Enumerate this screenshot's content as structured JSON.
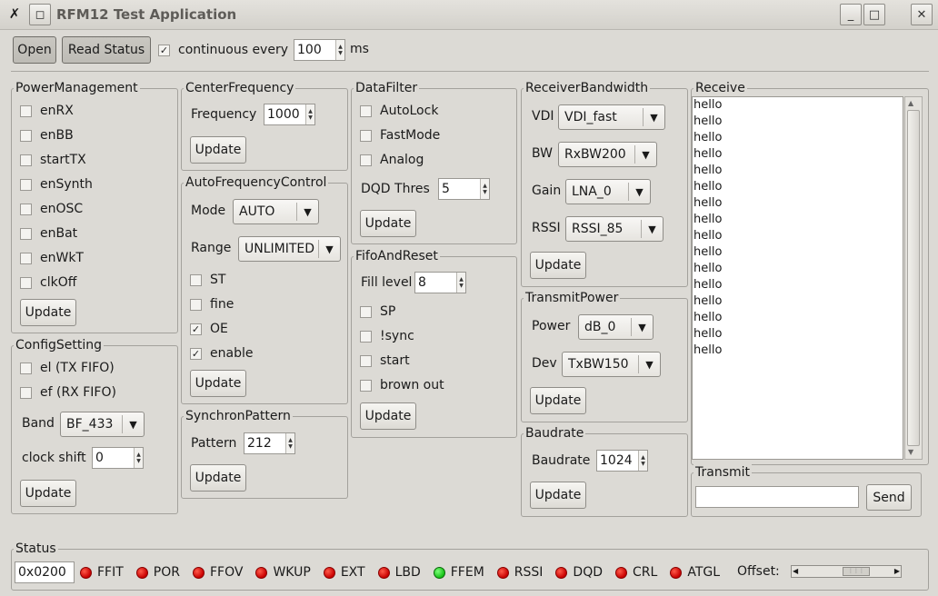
{
  "window": {
    "title": "RFM12 Test Application",
    "minimize": "_",
    "maximize": "□",
    "close": "✕",
    "menu_glyph": "✗",
    "pin_glyph": "◻"
  },
  "toolbar": {
    "open": "Open",
    "read_status": "Read Status",
    "continuous": "continuous every",
    "continuous_checked": true,
    "interval": "100",
    "unit": "ms"
  },
  "power": {
    "title": "PowerManagement",
    "items": [
      {
        "label": "enRX"
      },
      {
        "label": "enBB"
      },
      {
        "label": "startTX"
      },
      {
        "label": "enSynth"
      },
      {
        "label": "enOSC"
      },
      {
        "label": "enBat"
      },
      {
        "label": "enWkT"
      },
      {
        "label": "clkOff"
      }
    ],
    "update": "Update"
  },
  "config": {
    "title": "ConfigSetting",
    "el": "el (TX FIFO)",
    "ef": "ef (RX FIFO)",
    "band_label": "Band",
    "band_value": "BF_433",
    "clock_label": "clock shift",
    "clock_value": "0",
    "update": "Update"
  },
  "center": {
    "title": "CenterFrequency",
    "freq_label": "Frequency",
    "freq_value": "1000",
    "update": "Update"
  },
  "afc": {
    "title": "AutoFrequencyControl",
    "mode_label": "Mode",
    "mode_value": "AUTO",
    "range_label": "Range",
    "range_value": "UNLIMITED",
    "st": "ST",
    "fine": "fine",
    "oe": "OE",
    "enable": "enable",
    "update": "Update"
  },
  "sync": {
    "title": "SynchronPattern",
    "label": "Pattern",
    "value": "212",
    "update": "Update"
  },
  "datafilter": {
    "title": "DataFilter",
    "autolock": "AutoLock",
    "fastmode": "FastMode",
    "analog": "Analog",
    "dqd_label": "DQD Thres",
    "dqd_value": "5",
    "update": "Update"
  },
  "fifo": {
    "title": "FifoAndReset",
    "fill_label": "Fill level",
    "fill_value": "8",
    "sp": "SP",
    "nsync": "!sync",
    "start": "start",
    "brownout": "brown out",
    "update": "Update"
  },
  "rxbw": {
    "title": "ReceiverBandwidth",
    "vdi_label": "VDI",
    "vdi_value": "VDI_fast",
    "bw_label": "BW",
    "bw_value": "RxBW200",
    "gain_label": "Gain",
    "gain_value": "LNA_0",
    "rssi_label": "RSSI",
    "rssi_value": "RSSI_85",
    "update": "Update"
  },
  "txpower": {
    "title": "TransmitPower",
    "power_label": "Power",
    "power_value": "dB_0",
    "dev_label": "Dev",
    "dev_value": "TxBW150",
    "update": "Update"
  },
  "baud": {
    "title": "Baudrate",
    "label": "Baudrate",
    "value": "1024",
    "update": "Update"
  },
  "receive": {
    "title": "Receive",
    "lines": [
      "hello",
      "hello",
      "hello",
      "hello",
      "hello",
      "hello",
      "hello",
      "hello",
      "hello",
      "hello",
      "hello",
      "hello",
      "hello",
      "hello",
      "hello",
      "hello"
    ]
  },
  "transmit": {
    "title": "Transmit",
    "input_value": "",
    "send": "Send"
  },
  "status": {
    "title": "Status",
    "value": "0x0200",
    "flags": [
      {
        "label": "FFIT",
        "color": "red"
      },
      {
        "label": "POR",
        "color": "red"
      },
      {
        "label": "FFOV",
        "color": "red"
      },
      {
        "label": "WKUP",
        "color": "red"
      },
      {
        "label": "EXT",
        "color": "red"
      },
      {
        "label": "LBD",
        "color": "red"
      },
      {
        "label": "FFEM",
        "color": "green"
      },
      {
        "label": "RSSI",
        "color": "red"
      },
      {
        "label": "DQD",
        "color": "red"
      },
      {
        "label": "CRL",
        "color": "red"
      },
      {
        "label": "ATGL",
        "color": "red"
      }
    ],
    "offset_label": "Offset:"
  }
}
